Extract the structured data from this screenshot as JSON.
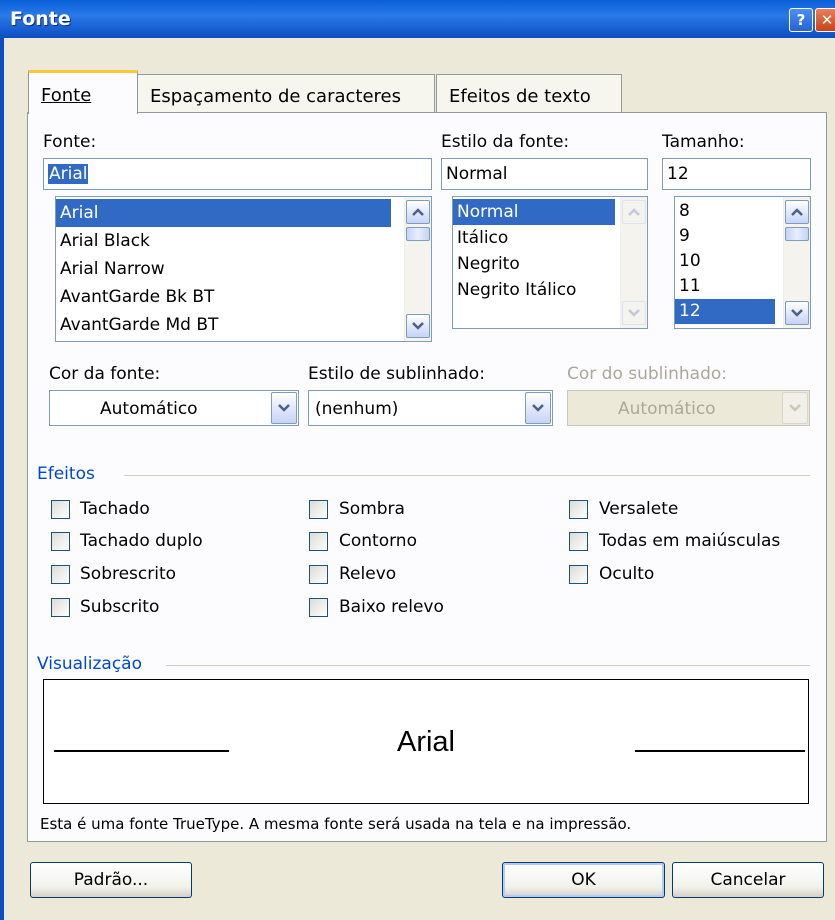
{
  "window": {
    "title": "Fonte",
    "help": "?",
    "close": "✕"
  },
  "tabs": [
    {
      "label": "Fonte",
      "active": true
    },
    {
      "label": "Espaçamento de caracteres",
      "active": false
    },
    {
      "label": "Efeitos de texto",
      "active": false
    }
  ],
  "font": {
    "label": "Fonte:",
    "value": "Arial",
    "list": [
      "Arial",
      "Arial Black",
      "Arial Narrow",
      "AvantGarde Bk BT",
      "AvantGarde Md BT"
    ],
    "selected": "Arial"
  },
  "style": {
    "label": "Estilo da fonte:",
    "value": "Normal",
    "list": [
      "Normal",
      "Itálico",
      "Negrito",
      "Negrito Itálico"
    ],
    "selected": "Normal"
  },
  "size": {
    "label": "Tamanho:",
    "value": "12",
    "list": [
      "8",
      "9",
      "10",
      "11",
      "12"
    ],
    "selected": "12"
  },
  "font_color": {
    "label": "Cor da fonte:",
    "value": "Automático"
  },
  "underline_style": {
    "label": "Estilo de sublinhado:",
    "value": "(nenhum)"
  },
  "underline_color": {
    "label": "Cor do sublinhado:",
    "value": "Automático",
    "disabled": true
  },
  "effects": {
    "title": "Efeitos",
    "col1": [
      "Tachado",
      "Tachado duplo",
      "Sobrescrito",
      "Subscrito"
    ],
    "col2": [
      "Sombra",
      "Contorno",
      "Relevo",
      "Baixo relevo"
    ],
    "col3": [
      "Versalete",
      "Todas em maiúsculas",
      "Oculto"
    ]
  },
  "preview": {
    "title": "Visualização",
    "sample": "Arial",
    "note": "Esta é uma fonte TrueType. A mesma fonte será usada na tela e na impressão."
  },
  "buttons": {
    "default": "Padrão...",
    "ok": "OK",
    "cancel": "Cancelar"
  },
  "colors": {
    "titlebar": "#0A5FD8",
    "selection": "#316AC5",
    "group_text": "#0046D5",
    "dialog_bg": "#ECE9D8",
    "tab_accent": "#FFC83C"
  }
}
